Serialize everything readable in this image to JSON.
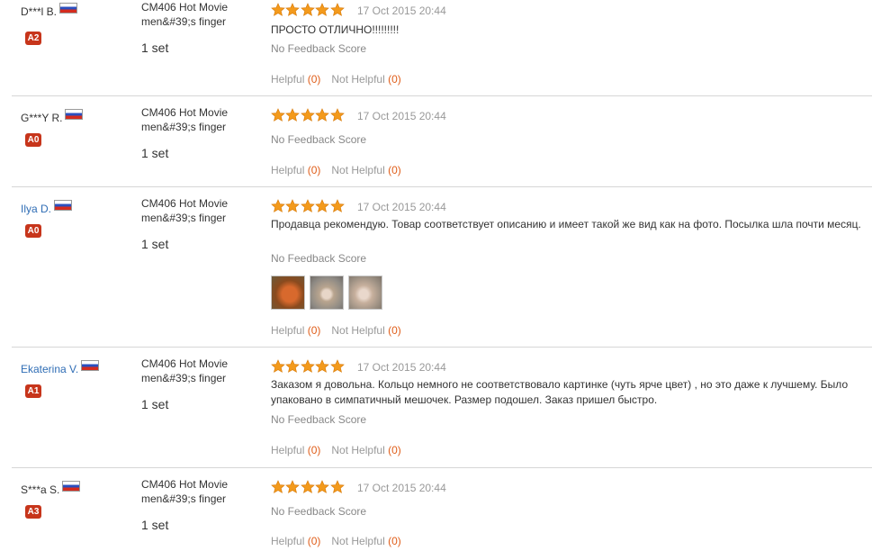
{
  "reviews": [
    {
      "user": "D***l B.",
      "user_is_link": false,
      "level": "A2",
      "product": [
        "CM406 Hot Movie",
        "men&#39;s finger"
      ],
      "qty": "1 set",
      "rating": 5,
      "date": "17 Oct 2015 20:44",
      "text": "ПРОСТО ОТЛИЧНО!!!!!!!!!",
      "feedback_score": "No Feedback Score",
      "helpful_label": "Helpful",
      "helpful_count": "(0)",
      "not_helpful_label": "Not Helpful",
      "not_helpful_count": "(0)"
    },
    {
      "user": "G***Y R.",
      "user_is_link": false,
      "level": "A0",
      "product": [
        "CM406 Hot Movie",
        "men&#39;s finger"
      ],
      "qty": "1 set",
      "rating": 5,
      "date": "17 Oct 2015 20:44",
      "text": "",
      "feedback_score": "No Feedback Score",
      "helpful_label": "Helpful",
      "helpful_count": "(0)",
      "not_helpful_label": "Not Helpful",
      "not_helpful_count": "(0)"
    },
    {
      "user": "Ilya D.",
      "user_is_link": true,
      "level": "A0",
      "product": [
        "CM406 Hot Movie",
        "men&#39;s finger"
      ],
      "qty": "1 set",
      "rating": 5,
      "date": "17 Oct 2015 20:44",
      "text": "Продавца рекомендую. Товар соответствует описанию и имеет такой же вид как на фото. Посылка шла почти месяц.",
      "feedback_score": "No Feedback Score",
      "photos": 3,
      "helpful_label": "Helpful",
      "helpful_count": "(0)",
      "not_helpful_label": "Not Helpful",
      "not_helpful_count": "(0)"
    },
    {
      "user": "Ekaterina V.",
      "user_is_link": true,
      "level": "A1",
      "product": [
        "CM406 Hot Movie",
        "men&#39;s finger"
      ],
      "qty": "1 set",
      "rating": 5,
      "date": "17 Oct 2015 20:44",
      "text": "Заказом я довольна. Кольцо немного не соответствовало картинке (чуть ярче цвет) , но это даже к лучшему. Было упаковано в симпатичный мешочек. Размер подошел. Заказ пришел быстро.",
      "feedback_score": "No Feedback Score",
      "helpful_label": "Helpful",
      "helpful_count": "(0)",
      "not_helpful_label": "Not Helpful",
      "not_helpful_count": "(0)"
    },
    {
      "user": "S***a S.",
      "user_is_link": false,
      "level": "A3",
      "product": [
        "CM406 Hot Movie",
        "men&#39;s finger"
      ],
      "qty": "1 set",
      "rating": 5,
      "date": "17 Oct 2015 20:44",
      "text": "",
      "feedback_score": "No Feedback Score",
      "helpful_label": "Helpful",
      "helpful_count": "(0)",
      "not_helpful_label": "Not Helpful",
      "not_helpful_count": "(0)"
    }
  ],
  "colors": {
    "star": "#f39a1c",
    "level_badge": "#c7351b",
    "link": "#2f6db5",
    "count": "#e05e1a"
  }
}
